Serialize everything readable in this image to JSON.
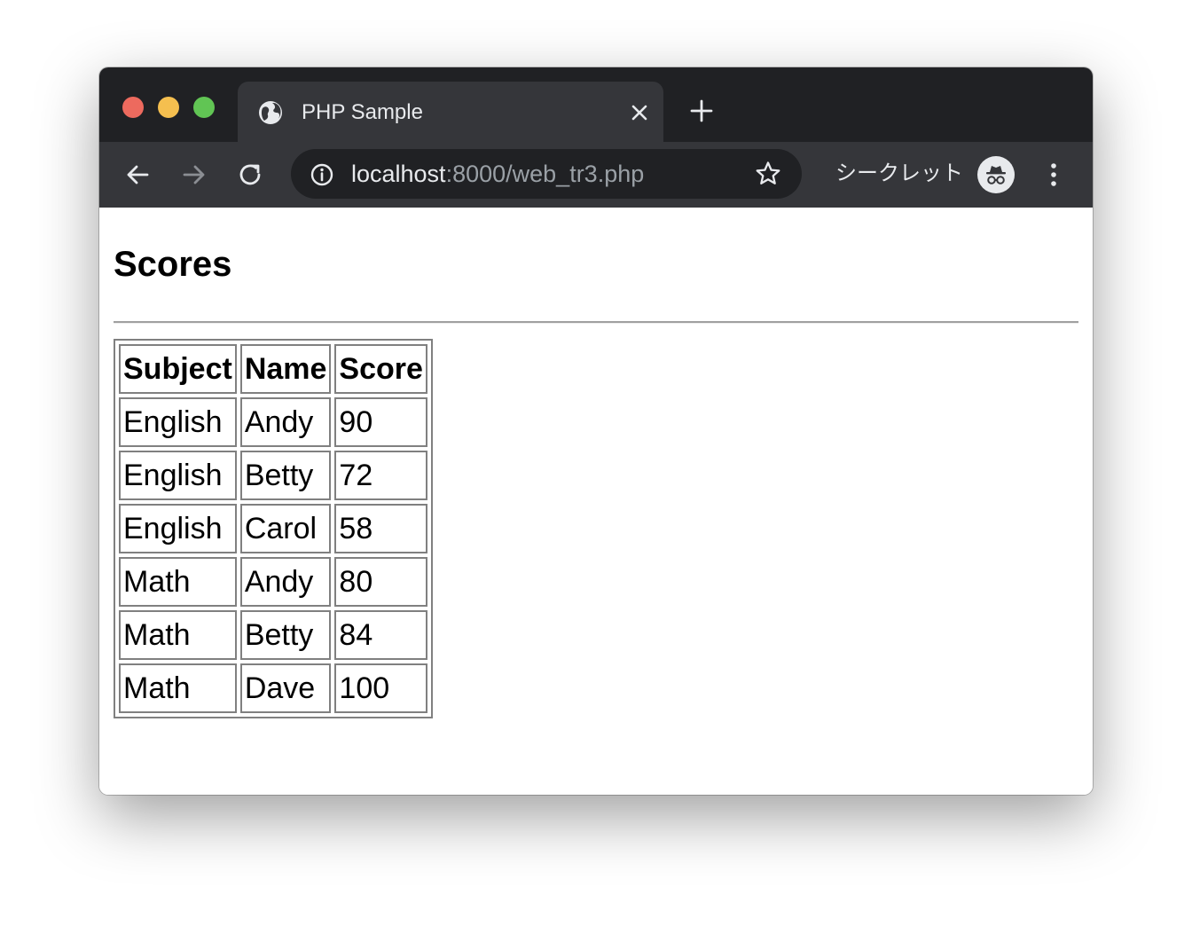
{
  "browser": {
    "tab": {
      "title": "PHP Sample",
      "icon": "globe-icon"
    },
    "new_tab_icon": "plus-icon",
    "address": {
      "host": "localhost",
      "rest": ":8000/web_tr3.php"
    },
    "incognito_label": "シークレット",
    "colors": {
      "titlebar": "#202124",
      "toolbar": "#35363a",
      "omnibox": "#202124",
      "close": "#ed6a5e",
      "minimize": "#f5bf4f",
      "maximize": "#61c554"
    }
  },
  "page": {
    "title": "Scores",
    "table": {
      "headers": [
        "Subject",
        "Name",
        "Score"
      ],
      "rows": [
        [
          "English",
          "Andy",
          "90"
        ],
        [
          "English",
          "Betty",
          "72"
        ],
        [
          "English",
          "Carol",
          "58"
        ],
        [
          "Math",
          "Andy",
          "80"
        ],
        [
          "Math",
          "Betty",
          "84"
        ],
        [
          "Math",
          "Dave",
          "100"
        ]
      ]
    }
  }
}
